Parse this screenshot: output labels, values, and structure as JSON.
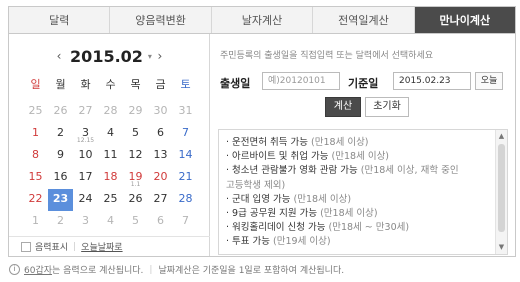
{
  "tabs": [
    {
      "label": "달력"
    },
    {
      "label": "양음력변환"
    },
    {
      "label": "날자계산"
    },
    {
      "label": "전역일계산"
    },
    {
      "label": "만나이계산"
    }
  ],
  "calendar": {
    "prev_icon": "‹",
    "month": "2015.02",
    "next_icon": "›",
    "dropdown_icon": "▾",
    "weekdays": [
      "일",
      "월",
      "화",
      "수",
      "목",
      "금",
      "토"
    ],
    "days": [
      {
        "d": "25",
        "t": "other"
      },
      {
        "d": "26",
        "t": "other"
      },
      {
        "d": "27",
        "t": "other"
      },
      {
        "d": "28",
        "t": "other"
      },
      {
        "d": "29",
        "t": "other"
      },
      {
        "d": "30",
        "t": "other"
      },
      {
        "d": "31",
        "t": "other"
      },
      {
        "d": "1",
        "t": "sun"
      },
      {
        "d": "2",
        "t": ""
      },
      {
        "d": "3",
        "t": "",
        "lunar": "12.15"
      },
      {
        "d": "4",
        "t": ""
      },
      {
        "d": "5",
        "t": ""
      },
      {
        "d": "6",
        "t": ""
      },
      {
        "d": "7",
        "t": "sat"
      },
      {
        "d": "8",
        "t": "sun"
      },
      {
        "d": "9",
        "t": ""
      },
      {
        "d": "10",
        "t": ""
      },
      {
        "d": "11",
        "t": ""
      },
      {
        "d": "12",
        "t": ""
      },
      {
        "d": "13",
        "t": ""
      },
      {
        "d": "14",
        "t": "sat"
      },
      {
        "d": "15",
        "t": "sun"
      },
      {
        "d": "16",
        "t": ""
      },
      {
        "d": "17",
        "t": ""
      },
      {
        "d": "18",
        "t": "hol"
      },
      {
        "d": "19",
        "t": "hol",
        "lunar": "1.1"
      },
      {
        "d": "20",
        "t": "hol"
      },
      {
        "d": "21",
        "t": "sat"
      },
      {
        "d": "22",
        "t": "sun"
      },
      {
        "d": "23",
        "t": "today"
      },
      {
        "d": "24",
        "t": ""
      },
      {
        "d": "25",
        "t": ""
      },
      {
        "d": "26",
        "t": ""
      },
      {
        "d": "27",
        "t": ""
      },
      {
        "d": "28",
        "t": "sat"
      },
      {
        "d": "1",
        "t": "other"
      },
      {
        "d": "2",
        "t": "other"
      },
      {
        "d": "3",
        "t": "other"
      },
      {
        "d": "4",
        "t": "other"
      },
      {
        "d": "5",
        "t": "other"
      },
      {
        "d": "6",
        "t": "other"
      },
      {
        "d": "7",
        "t": "other"
      }
    ],
    "lunar_label": "음력표시",
    "today_link": "오늘날짜로"
  },
  "form": {
    "hint": "주민등록의 출생일을 직접입력 또는 달력에서 선택하세요",
    "birth_label": "출생일",
    "birth_placeholder": "예)20120101",
    "base_label": "기준일",
    "base_value": "2015.02.23",
    "today_button": "오늘",
    "calc_button": "계산",
    "reset_button": "초기화"
  },
  "results": [
    {
      "main": "운전면허 취득 가능",
      "sub": "(만18세 이상)"
    },
    {
      "main": "아르바이트 및 취업 가능",
      "sub": "(만18세 이상)"
    },
    {
      "main": "청소년 관람불가 영화 관람 가능",
      "sub": "(만18세 이상, 재학 중인"
    },
    {
      "main": "",
      "sub": "고등학생 제외)"
    },
    {
      "main": "군대 입영 가능",
      "sub": "(만18세 이상)"
    },
    {
      "main": "9급 공무원 지원 가능",
      "sub": "(만18세 이상)"
    },
    {
      "main": "워킹홀리데이 신청 가능",
      "sub": "(만18세 ~ 만30세)"
    },
    {
      "main": "투표 가능",
      "sub": "(만19세 이상)"
    }
  ],
  "footer": {
    "info_icon": "i",
    "link": "60갑자",
    "text1": "는 음력으로 계산됩니다.",
    "text2": "날짜계산은 기준일을 1일로 포함하여 계산됩니다."
  }
}
